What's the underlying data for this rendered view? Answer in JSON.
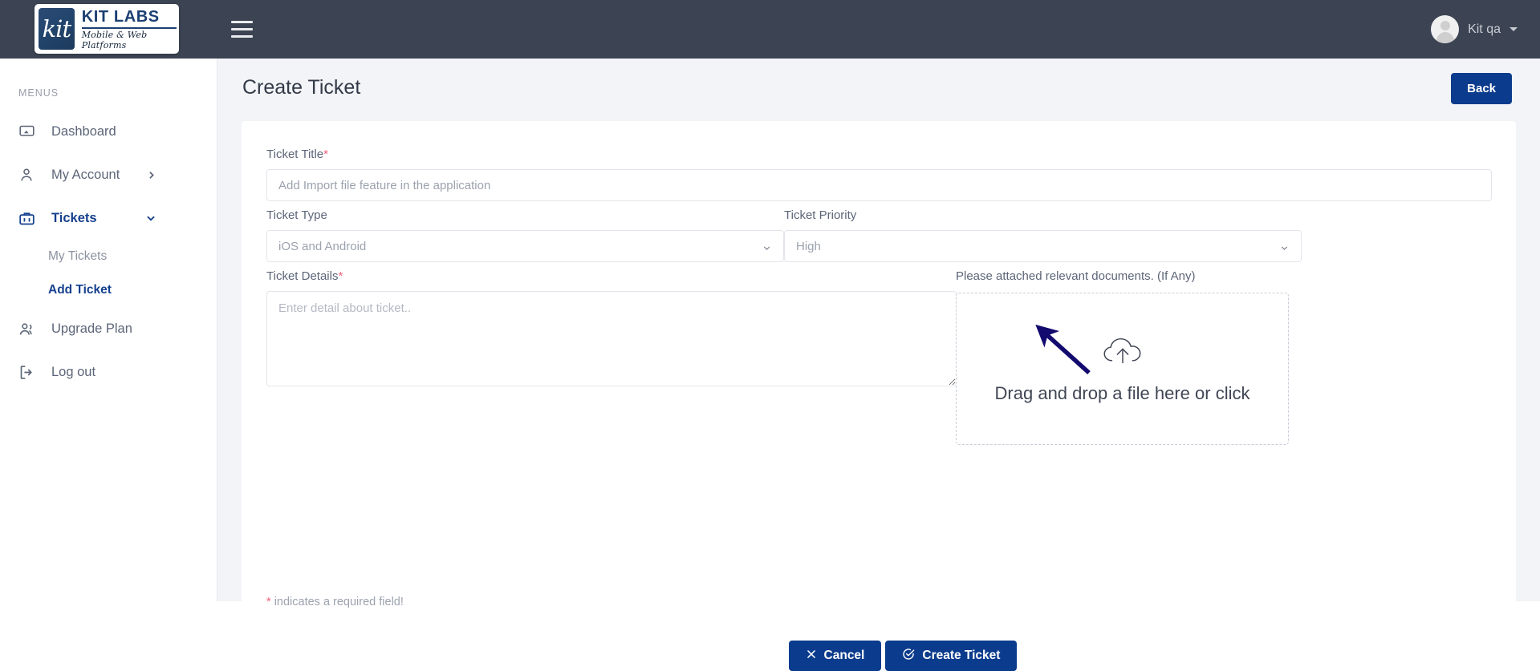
{
  "topbar": {
    "logo": {
      "mark_text": "kit",
      "title": "KIT LABS",
      "subtitle": "Mobile & Web Platforms"
    },
    "menu_toggle_name": "hamburger-menu-icon",
    "user": {
      "name": "Kit qa",
      "caret": "chevron-down-icon"
    },
    "bg_color": "#3c4453"
  },
  "sidebar": {
    "section_label": "MENUS",
    "items": [
      {
        "label": "Dashboard",
        "icon": "dashboard-icon",
        "active": false,
        "chevron": ""
      },
      {
        "label": "My Account",
        "icon": "user-icon",
        "active": false,
        "chevron": "chevron-right-icon"
      },
      {
        "label": "Tickets",
        "icon": "briefcase-icon",
        "active": true,
        "chevron": "chevron-down-icon"
      },
      {
        "label": "Upgrade Plan",
        "icon": "users-icon",
        "active": false,
        "chevron": ""
      },
      {
        "label": "Log out",
        "icon": "logout-icon",
        "active": false,
        "chevron": ""
      }
    ],
    "submenu": [
      {
        "label": "My Tickets",
        "active": false
      },
      {
        "label": "Add Ticket",
        "active": true
      }
    ],
    "accent_color": "#16408e",
    "muted_color": "#5c6578"
  },
  "page": {
    "title": "Create Ticket",
    "back_label": "Back",
    "back_color": "#0b3b8c"
  },
  "form": {
    "ticket_title": {
      "label": "Ticket Title",
      "required": true,
      "required_mark": "*",
      "placeholder": "Add Import file feature in the application",
      "value": ""
    },
    "ticket_type": {
      "label": "Ticket Type",
      "required": false,
      "selected": "iOS and Android",
      "options": [
        "iOS and Android"
      ],
      "chevron": "chevron-down-icon"
    },
    "ticket_priority": {
      "label": "Ticket Priority",
      "required": false,
      "selected": "High",
      "options": [
        "High"
      ],
      "chevron": "chevron-down-icon"
    },
    "ticket_details": {
      "label": "Ticket Details",
      "required": true,
      "required_mark": "*",
      "placeholder": "Enter detail about ticket..",
      "value": ""
    },
    "attachment": {
      "label": "Please attached relevant documents. (If Any)",
      "dropzone_text": "Drag and drop a file here or click",
      "icon": "cloud-upload-icon"
    },
    "required_note": "indicates a required field!",
    "required_note_mark": "*",
    "buttons": [
      {
        "label": "Cancel",
        "icon": "close-icon"
      },
      {
        "label": "Create Ticket",
        "icon": "check-circle-icon"
      }
    ]
  },
  "annotation": {
    "name": "pointer-arrow",
    "color": "#120a6e",
    "points_at": "ticket-priority-select"
  }
}
